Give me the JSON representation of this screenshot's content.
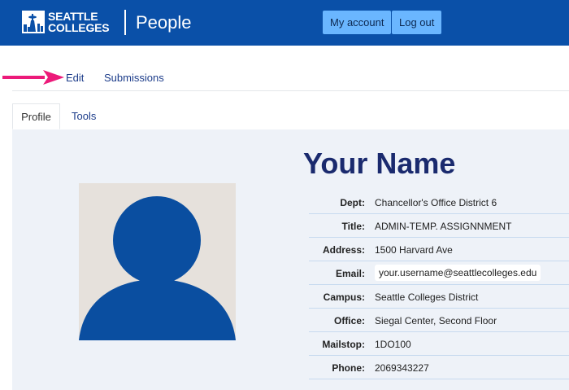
{
  "header": {
    "logo_line1": "SEATTLE",
    "logo_line2": "COLLEGES",
    "app_title": "People",
    "my_account_label": "My account",
    "logout_label": "Log out",
    "bg_color": "#0a50a8",
    "button_color": "#6ab6ff"
  },
  "primary_tabs": {
    "edit_label": "Edit",
    "submissions_label": "Submissions",
    "arrow_icon": "right-arrow-icon",
    "arrow_color": "#ec1a7a"
  },
  "secondary_tabs": {
    "profile_label": "Profile",
    "tools_label": "Tools",
    "active": "Profile"
  },
  "profile": {
    "name": "Your Name",
    "photo_icon": "person-placeholder-icon",
    "fields": [
      {
        "label": "Dept:",
        "value": "Chancellor's Office District 6"
      },
      {
        "label": "Title:",
        "value": "ADMIN-TEMP. ASSIGNNMENT"
      },
      {
        "label": "Address:",
        "value": "1500 Harvard Ave"
      },
      {
        "label": "Email:",
        "value": "your.username@seattlecolleges.edu"
      },
      {
        "label": "Campus:",
        "value": "Seattle Colleges District"
      },
      {
        "label": "Office:",
        "value": "Siegal Center, Second Floor"
      },
      {
        "label": "Mailstop:",
        "value": "1DO100"
      },
      {
        "label": "Phone:",
        "value": "2069343227"
      }
    ]
  }
}
